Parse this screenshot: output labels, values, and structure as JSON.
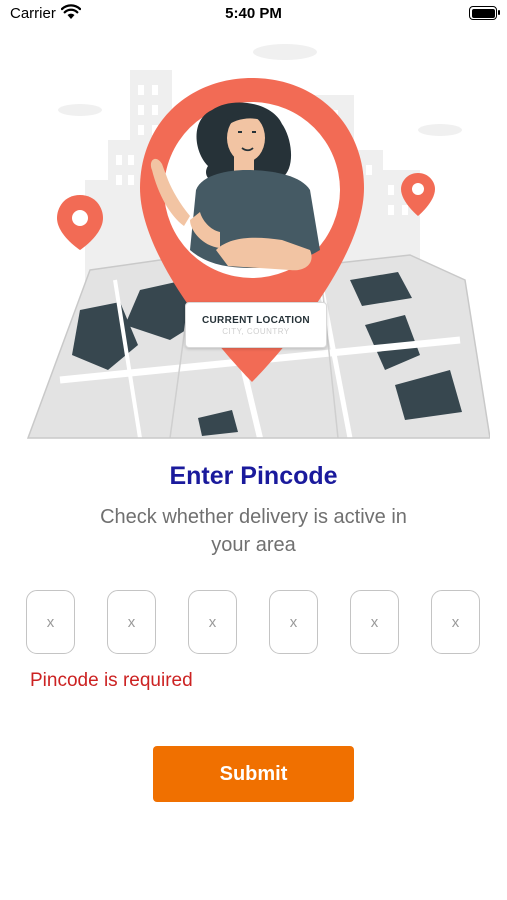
{
  "status_bar": {
    "carrier": "Carrier",
    "time": "5:40 PM"
  },
  "illustration": {
    "card_title": "CURRENT LOCATION",
    "card_subtitle": "CITY, COUNTRY"
  },
  "heading": {
    "title": "Enter Pincode",
    "subtitle": "Check whether delivery is active in your area"
  },
  "pincode": {
    "placeholders": [
      "x",
      "x",
      "x",
      "x",
      "x",
      "x"
    ],
    "error": "Pincode is required"
  },
  "actions": {
    "submit_label": "Submit"
  },
  "colors": {
    "title": "#1a1a9c",
    "pin_marker": "#f26b55",
    "map_dark": "#37474f",
    "error": "#cc2222",
    "submit": "#f07000"
  }
}
